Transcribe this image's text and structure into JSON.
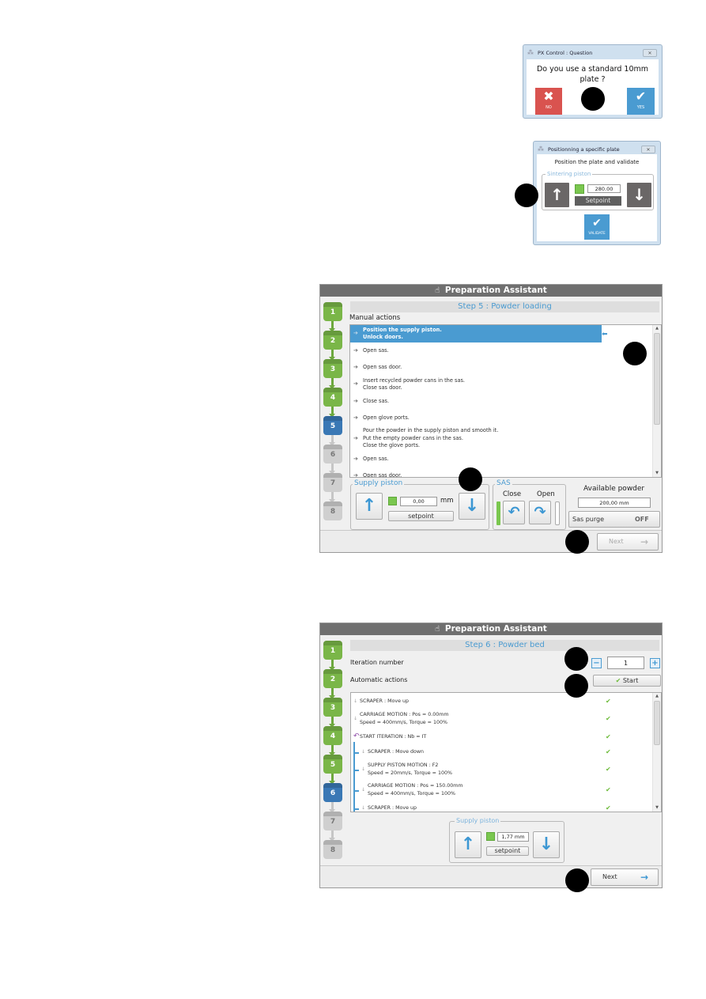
{
  "question_dialog": {
    "title": "PX Control : Question",
    "close_label": "✕",
    "message_line1": "Do you use a standard 10mm",
    "message_line2": "plate ?",
    "no_button": {
      "glyph": "✖",
      "label": "NO",
      "color": "#d9534f"
    },
    "yes_button": {
      "glyph": "✔",
      "label": "YES",
      "color": "#4a9bd1"
    }
  },
  "positioning_dialog": {
    "title": "Positionning a specific plate",
    "close_label": "✕",
    "message": "Position the plate and validate",
    "group_label": "Sintering piston",
    "up_glyph": "↑",
    "down_glyph": "↓",
    "value": "280.00",
    "setpoint_label": "Setpoint",
    "validate_button": {
      "glyph": "✔",
      "label": "VALIDATE"
    }
  },
  "assistant_step5": {
    "title": "Preparation Assistant",
    "hand_icon": "☝",
    "steps": [
      {
        "n": "1",
        "state": "done"
      },
      {
        "n": "2",
        "state": "done"
      },
      {
        "n": "3",
        "state": "done"
      },
      {
        "n": "4",
        "state": "done"
      },
      {
        "n": "5",
        "state": "current"
      },
      {
        "n": "6",
        "state": "todo"
      },
      {
        "n": "7",
        "state": "todo"
      },
      {
        "n": "8",
        "state": "todo"
      }
    ],
    "step_header": "Step 5 : Powder loading",
    "section_label": "Manual actions",
    "actions": [
      {
        "lines": [
          "Position the supply piston.",
          "Unlock doors."
        ],
        "selected": true
      },
      {
        "lines": [
          "Open sas."
        ],
        "selected": false
      },
      {
        "lines": [
          "Open sas door."
        ],
        "selected": false
      },
      {
        "lines": [
          "Insert recycled powder cans in the sas.",
          "Close sas door."
        ],
        "selected": false
      },
      {
        "lines": [
          "Close sas."
        ],
        "selected": false
      },
      {
        "lines": [
          "Open glove ports."
        ],
        "selected": false
      },
      {
        "lines": [
          "Pour the powder in the supply piston and smooth it.",
          "Put the empty powder cans in the sas.",
          "Close the glove ports."
        ],
        "selected": false
      },
      {
        "lines": [
          "Open sas."
        ],
        "selected": false
      },
      {
        "lines": [
          "Open sas door."
        ],
        "selected": false
      }
    ],
    "current_pointer": "⬅",
    "supply_piston": {
      "label": "Supply piston",
      "value": "0,00",
      "unit": "mm",
      "setpoint_label": "setpoint",
      "up_glyph": "↑",
      "down_glyph": "↓"
    },
    "sas": {
      "label": "SAS",
      "close_label": "Close",
      "open_label": "Open",
      "close_glyph": "↶",
      "open_glyph": "↷"
    },
    "available_powder": {
      "label": "Available powder",
      "value": "200,00 mm"
    },
    "sas_purge": {
      "label": "Sas purge",
      "state": "OFF"
    },
    "next_button": {
      "label": "Next",
      "arrow": "→",
      "enabled": false
    }
  },
  "assistant_step6": {
    "title": "Preparation Assistant",
    "hand_icon": "☝",
    "steps": [
      {
        "n": "1",
        "state": "done"
      },
      {
        "n": "2",
        "state": "done"
      },
      {
        "n": "3",
        "state": "done"
      },
      {
        "n": "4",
        "state": "done"
      },
      {
        "n": "5",
        "state": "done"
      },
      {
        "n": "6",
        "state": "current"
      },
      {
        "n": "7",
        "state": "todo"
      },
      {
        "n": "8",
        "state": "todo"
      }
    ],
    "step_header": "Step 6 : Powder bed",
    "iteration_label": "Iteration number",
    "iteration_value": "1",
    "minus_label": "−",
    "plus_label": "+",
    "automatic_label": "Automatic actions",
    "start_button": {
      "check": "✔",
      "label": "Start"
    },
    "actions": [
      {
        "lines": [
          "SCRAPER : Move up"
        ],
        "icon": "arrow",
        "indent": false,
        "status": "✔"
      },
      {
        "lines": [
          "CARRIAGE MOTION : Pos = 0.00mm",
          "Speed = 400mm/s, Torque = 100%"
        ],
        "icon": "arrow",
        "indent": false,
        "status": "✔"
      },
      {
        "lines": [
          "START ITERATION : Nb = IT"
        ],
        "icon": "loop",
        "indent": false,
        "status": "✔"
      },
      {
        "lines": [
          "SCRAPER : Move down"
        ],
        "icon": "arrow",
        "indent": true,
        "status": "✔"
      },
      {
        "lines": [
          "SUPPLY PISTON MOTION : F2",
          "Speed = 20mm/s, Torque = 100%"
        ],
        "icon": "arrow",
        "indent": true,
        "status": "✔"
      },
      {
        "lines": [
          "CARRIAGE MOTION : Pos = 150.00mm",
          "Speed = 400mm/s, Torque = 100%"
        ],
        "icon": "arrow",
        "indent": true,
        "status": "✔"
      },
      {
        "lines": [
          "SCRAPER : Move up"
        ],
        "icon": "arrow",
        "indent": true,
        "status": "✔"
      }
    ],
    "supply_piston": {
      "label": "Supply piston",
      "value": "1,77 mm",
      "setpoint_label": "setpoint",
      "up_glyph": "↑",
      "down_glyph": "↓"
    },
    "next_button": {
      "label": "Next",
      "arrow": "→",
      "enabled": true
    }
  }
}
